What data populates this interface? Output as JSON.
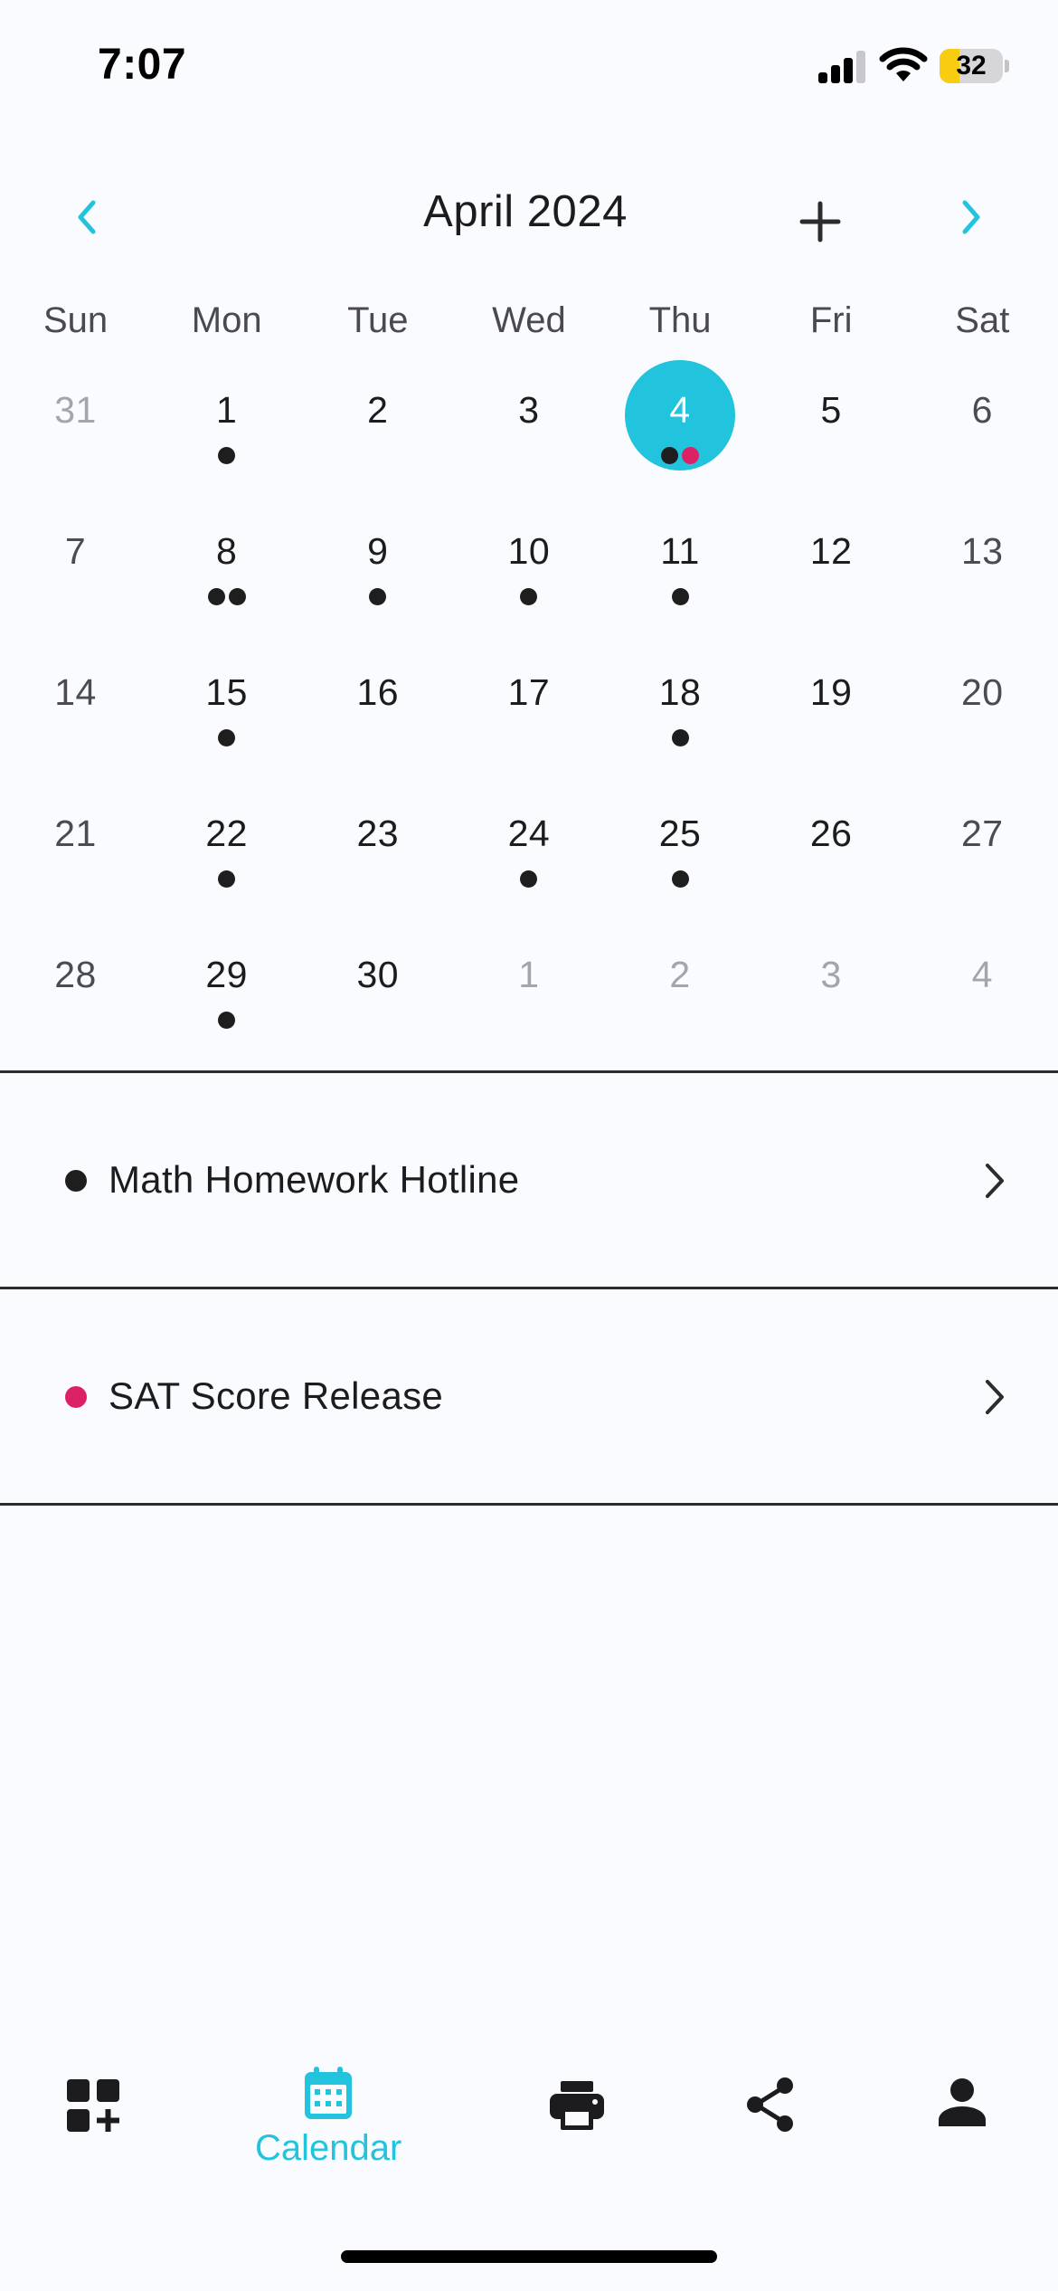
{
  "status_bar": {
    "time": "7:07",
    "battery": "32",
    "battery_level": 0.32
  },
  "header": {
    "month_title": "April 2024",
    "prev_icon": "chevron-left-icon",
    "next_icon": "chevron-right-icon",
    "add_icon": "plus-icon"
  },
  "colors": {
    "accent": "#21c3dd",
    "event_dark": "#1e1e1e",
    "event_pink": "#dc2166"
  },
  "weekdays": [
    "Sun",
    "Mon",
    "Tue",
    "Wed",
    "Thu",
    "Fri",
    "Sat"
  ],
  "weeks": [
    [
      {
        "day": "31",
        "other": true,
        "dots": []
      },
      {
        "day": "1",
        "dots": [
          "dark"
        ]
      },
      {
        "day": "2",
        "dots": []
      },
      {
        "day": "3",
        "dots": []
      },
      {
        "day": "4",
        "selected": true,
        "dots": [
          "dark",
          "pink"
        ]
      },
      {
        "day": "5",
        "dots": []
      },
      {
        "day": "6",
        "dots": []
      }
    ],
    [
      {
        "day": "7",
        "dots": []
      },
      {
        "day": "8",
        "dots": [
          "dark",
          "dark"
        ]
      },
      {
        "day": "9",
        "dots": [
          "dark"
        ]
      },
      {
        "day": "10",
        "dots": [
          "dark"
        ]
      },
      {
        "day": "11",
        "dots": [
          "dark"
        ]
      },
      {
        "day": "12",
        "dots": []
      },
      {
        "day": "13",
        "dots": []
      }
    ],
    [
      {
        "day": "14",
        "dots": []
      },
      {
        "day": "15",
        "dots": [
          "dark"
        ]
      },
      {
        "day": "16",
        "dots": []
      },
      {
        "day": "17",
        "dots": []
      },
      {
        "day": "18",
        "dots": [
          "dark"
        ]
      },
      {
        "day": "19",
        "dots": []
      },
      {
        "day": "20",
        "dots": []
      }
    ],
    [
      {
        "day": "21",
        "dots": []
      },
      {
        "day": "22",
        "dots": [
          "dark"
        ]
      },
      {
        "day": "23",
        "dots": []
      },
      {
        "day": "24",
        "dots": [
          "dark"
        ]
      },
      {
        "day": "25",
        "dots": [
          "dark"
        ]
      },
      {
        "day": "26",
        "dots": []
      },
      {
        "day": "27",
        "dots": []
      }
    ],
    [
      {
        "day": "28",
        "dots": []
      },
      {
        "day": "29",
        "dots": [
          "dark"
        ]
      },
      {
        "day": "30",
        "dots": []
      },
      {
        "day": "1",
        "other": true,
        "dots": []
      },
      {
        "day": "2",
        "other": true,
        "dots": []
      },
      {
        "day": "3",
        "other": true,
        "dots": []
      },
      {
        "day": "4",
        "other": true,
        "dots": []
      }
    ]
  ],
  "events": [
    {
      "title": "Math Homework Hotline",
      "color": "#1e1e1e"
    },
    {
      "title": "SAT Score Release",
      "color": "#dc2166"
    }
  ],
  "tab_bar": {
    "tabs": [
      {
        "icon": "widgets-add-icon",
        "label": ""
      },
      {
        "icon": "calendar-icon",
        "label": "Calendar",
        "active": true
      },
      {
        "icon": "printer-icon",
        "label": ""
      },
      {
        "icon": "share-icon",
        "label": ""
      },
      {
        "icon": "person-icon",
        "label": ""
      }
    ]
  }
}
